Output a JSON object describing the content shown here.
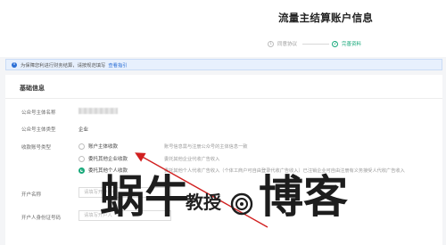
{
  "header": {
    "title": "流量主结算账户信息",
    "steps": [
      {
        "index": "1",
        "label": "同意协议",
        "active": false
      },
      {
        "index": "2",
        "label": "完善资料",
        "active": true
      }
    ]
  },
  "notice": {
    "icon": "info-icon",
    "text": "为保障您利进行财务结算，请按规范填写",
    "link": "查看指引"
  },
  "form": {
    "section_title": "基础信息",
    "entity_name_label": "公众号主体名称",
    "entity_type_label": "公众号主体类型",
    "entity_type_value": "企业",
    "payee_type_label": "收款账号类型",
    "options": [
      {
        "label": "账户主体收款",
        "desc": "账号信息需与注册公众号的主体信息一致",
        "selected": false
      },
      {
        "label": "委托其他企业收款",
        "desc": "委托其他企业代收广告收入",
        "selected": false
      },
      {
        "label": "委托其他个人收款",
        "desc": "委托其他个人代收广告收入（个体工商户可自由登录代收广告收入）已注销企业可自由注册有义务接受人代收广告收入",
        "selected": true
      }
    ],
    "account_name_label": "开户名称",
    "account_name_placeholder": "请填写开户名称",
    "id_number_label": "开户人身份证号码",
    "id_number_placeholder": "请填写开户人"
  },
  "watermark": {
    "part1": "蜗牛",
    "part2": "教授",
    "part3": "博客"
  },
  "colors": {
    "accent": "#19a97b",
    "link": "#2b6fd6",
    "arrow": "#d11f1f"
  }
}
